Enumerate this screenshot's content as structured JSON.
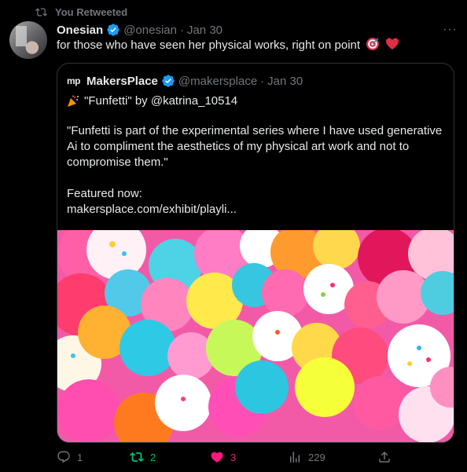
{
  "retweet": {
    "label": "You Retweeted"
  },
  "tweet": {
    "author_name": "Onesian",
    "author_handle": "@onesian",
    "date": "Jan 30",
    "separator": "·",
    "more": "···",
    "text": "for those who have seen her physical works, right on point"
  },
  "quote": {
    "logo": "mp",
    "author_name": "MakersPlace",
    "author_handle": "@makersplace",
    "date": "Jan 30",
    "separator": "·",
    "title_line": "\"Funfetti\" by @katrina_10514",
    "body": "\"Funfetti is part of the experimental series where I have used generative Ai to compliment the aesthetics of my physical art work and not to compromise them.\"\n\nFeatured now:\nmakersplace.com/exhibit/playli..."
  },
  "actions": {
    "replies": "1",
    "retweets": "2",
    "likes": "3",
    "views": "229"
  },
  "colors": {
    "verified": "#1d9bf0",
    "retweet_active": "#00ba7c",
    "like_active": "#f91880",
    "muted": "#71767b"
  },
  "icons": [
    "retweet-icon",
    "verified-badge-icon",
    "more-icon",
    "target-emoji",
    "heart-emoji",
    "party-popper-emoji",
    "reply-icon",
    "like-icon",
    "views-icon",
    "share-icon"
  ]
}
